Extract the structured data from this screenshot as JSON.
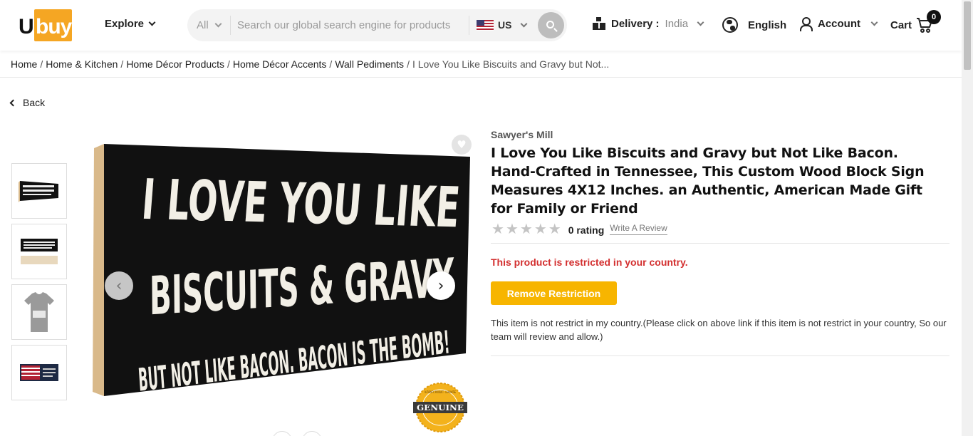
{
  "header": {
    "logo_prefix": "U",
    "logo_suffix": "buy",
    "explore_label": "Explore",
    "search": {
      "category": "All",
      "placeholder": "Search our global search engine for products",
      "country": "US"
    },
    "delivery_label": "Delivery :",
    "delivery_country": "India",
    "language": "English",
    "account_label": "Account",
    "cart_label": "Cart",
    "cart_count": "0"
  },
  "breadcrumb": {
    "items": [
      "Home",
      "Home & Kitchen",
      "Home Décor Products",
      "Home Décor Accents",
      "Wall Pediments"
    ],
    "current": "I Love You Like Biscuits and Gravy but Not..."
  },
  "back_label": "Back",
  "gallery": {
    "sign_line1": "I LOVE YOU LIKE",
    "sign_line2": "BISCUITS & GRAVY",
    "sign_line3": "BUT NOT LIKE BACON. BACON IS THE BOMB!",
    "thumbnails": [
      "sign-front",
      "sign-with-base",
      "shirt-print",
      "flag-sign"
    ],
    "genuine_badge": "GENUINE",
    "genuine_ring": "AUTHENTIC PRODUCT · GUARANTEE"
  },
  "product": {
    "brand": "Sawyer's Mill",
    "title": "I Love You Like Biscuits and Gravy but Not Like Bacon. Hand-Crafted in Tennessee, This Custom Wood Block Sign Measures 4X12 Inches. an Authentic, American Made Gift for Family or Friend",
    "rating": 0,
    "rating_text": "0 rating",
    "write_review": "Write A Review",
    "restriction_message": "This product is restricted in your country.",
    "remove_restriction_label": "Remove Restriction",
    "restriction_note": "This item is not restrict in my country.(Please click on above link if this item is not restrict in your country, So our team will review and allow.)"
  },
  "colors": {
    "brand_orange": "#f5a623",
    "button_yellow": "#f7b500",
    "error_red": "#d32f2f"
  }
}
